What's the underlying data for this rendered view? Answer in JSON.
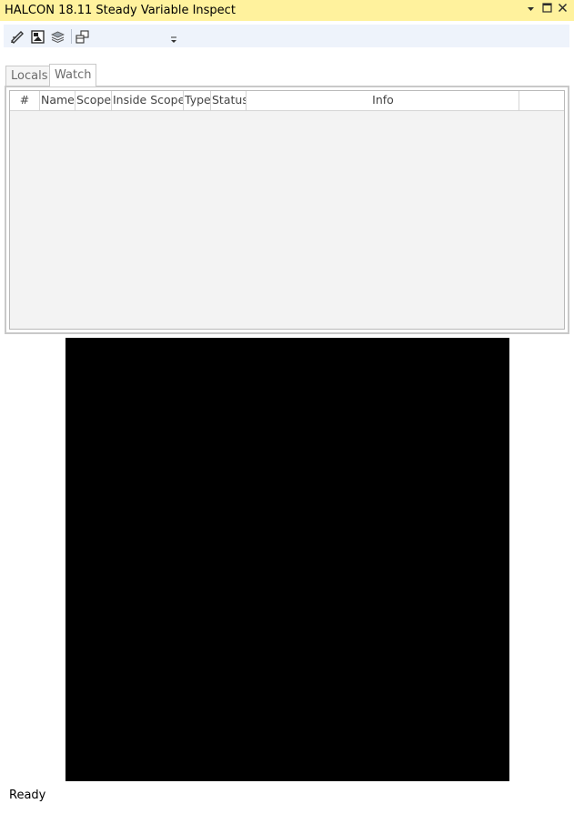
{
  "window": {
    "title": "HALCON 18.11 Steady Variable Inspect",
    "controls": [
      {
        "icon": "dropdown-arrow-icon",
        "glyph": "▼"
      },
      {
        "icon": "maximize-icon",
        "glyph": "🗖"
      },
      {
        "icon": "close-icon",
        "glyph": "✕"
      }
    ],
    "title_bg": "#fff29d"
  },
  "toolbar": {
    "buttons": [
      {
        "icon": "edit-pen-icon"
      },
      {
        "icon": "image-view-icon"
      },
      {
        "icon": "layers-icon"
      },
      {
        "icon": "window-arrange-icon"
      }
    ],
    "overflow_icon": "toolbar-overflow-icon"
  },
  "tabs": [
    {
      "label": "Locals",
      "active": false
    },
    {
      "label": "Watch",
      "active": true
    }
  ],
  "grid": {
    "columns": [
      "#",
      "Name",
      "Scope",
      "Inside Scope",
      "Type",
      "Status",
      "Info",
      ""
    ],
    "rows": []
  },
  "viewer": {
    "background": "#000000"
  },
  "statusbar": {
    "text": "Ready"
  }
}
